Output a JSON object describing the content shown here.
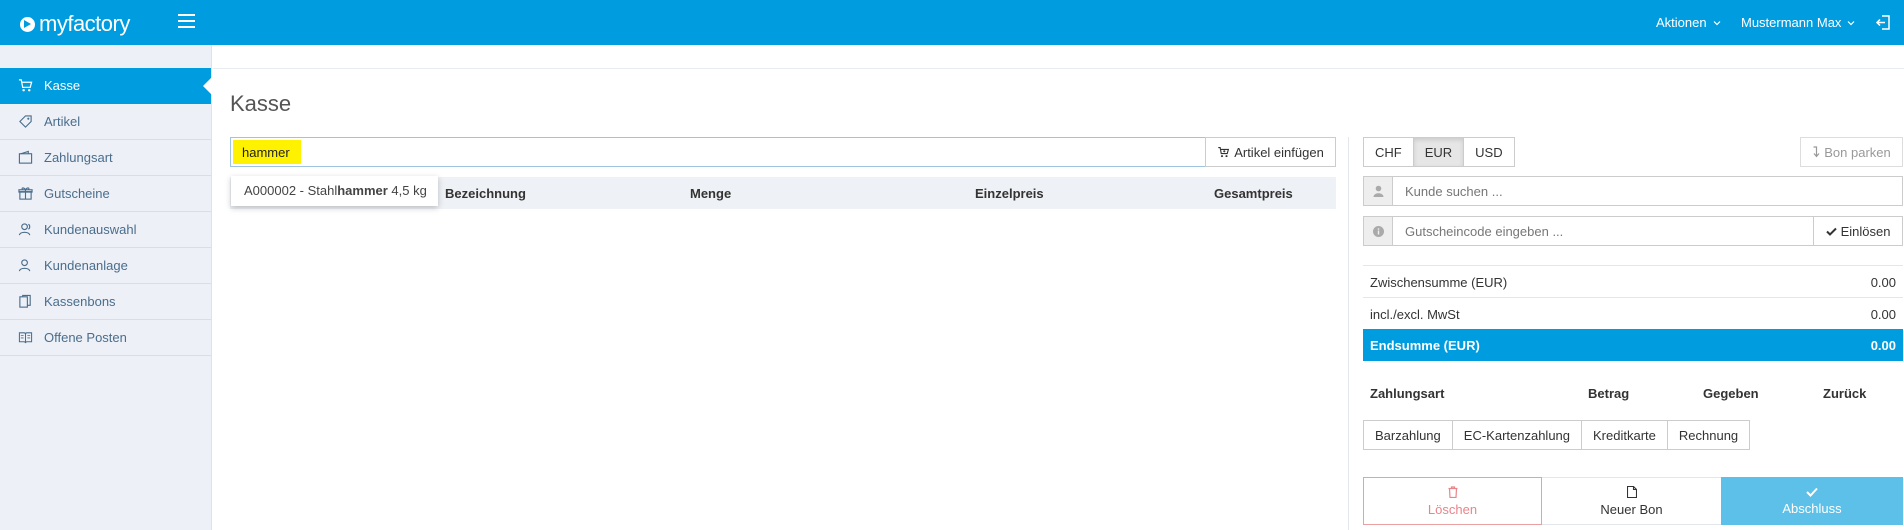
{
  "app": {
    "logo_text": "myfactory",
    "menu_actions": "Aktionen",
    "user": "Mustermann Max"
  },
  "sidebar": {
    "items": [
      {
        "label": "Kasse",
        "icon": "cart-icon",
        "active": true
      },
      {
        "label": "Artikel",
        "icon": "tag-icon"
      },
      {
        "label": "Zahlungsart",
        "icon": "wallet-icon"
      },
      {
        "label": "Gutscheine",
        "icon": "gift-icon"
      },
      {
        "label": "Kundenauswahl",
        "icon": "users-icon"
      },
      {
        "label": "Kundenanlage",
        "icon": "user-add-icon"
      },
      {
        "label": "Kassenbons",
        "icon": "receipts-icon"
      },
      {
        "label": "Offene Posten",
        "icon": "book-icon"
      }
    ]
  },
  "page": {
    "title": "Kasse"
  },
  "search": {
    "value": "hammer",
    "insert_label": "Artikel einfügen"
  },
  "suggestion": {
    "prefix": "A000002 - Stahl",
    "highlight": "hammer",
    "suffix": " 4,5 kg"
  },
  "table": {
    "columns": [
      "Bezeichnung",
      "Menge",
      "Einzelpreis",
      "Gesamtpreis"
    ]
  },
  "currency": {
    "options": [
      "CHF",
      "EUR",
      "USD"
    ],
    "selected": "EUR"
  },
  "park_label": "Bon parken",
  "customer": {
    "placeholder": "Kunde suchen ..."
  },
  "voucher": {
    "placeholder": "Gutscheincode eingeben ...",
    "redeem_label": "Einlösen"
  },
  "totals": {
    "subtotal_label": "Zwischensumme (EUR)",
    "subtotal_value": "0.00",
    "vat_label": "incl./excl. MwSt",
    "vat_value": "0.00",
    "total_label": "Endsumme (EUR)",
    "total_value": "0.00"
  },
  "payment": {
    "headers": [
      "Zahlungsart",
      "Betrag",
      "Gegeben",
      "Zurück"
    ],
    "methods": [
      "Barzahlung",
      "EC-Kartenzahlung",
      "Kreditkarte",
      "Rechnung"
    ]
  },
  "actions": {
    "delete_label": "Löschen",
    "new_label": "Neuer Bon",
    "finish_label": "Abschluss"
  },
  "colors": {
    "primary": "#009ce0",
    "highlight": "#fff200",
    "danger": "#e8858a"
  }
}
